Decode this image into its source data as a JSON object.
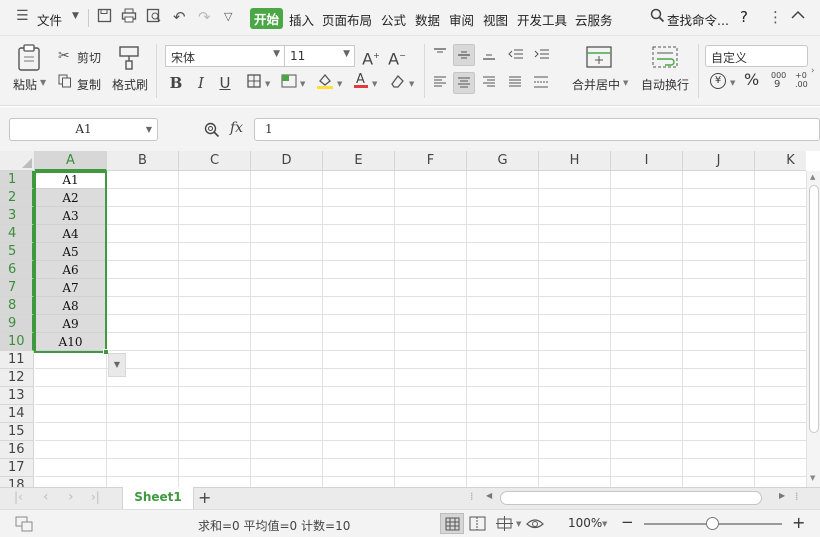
{
  "menubar": {
    "file_label": "文件",
    "tabs": [
      "开始",
      "插入",
      "页面布局",
      "公式",
      "数据",
      "审阅",
      "视图",
      "开发工具",
      "云服务"
    ],
    "search_label": "查找命令...",
    "help_label": "?"
  },
  "ribbon": {
    "paste_label": "粘贴",
    "cut_label": "剪切",
    "copy_label": "复制",
    "format_painter_label": "格式刷",
    "font_name": "宋体",
    "font_size": "11",
    "merge_label": "合并居中",
    "wrap_label": "自动换行",
    "number_format": "自定义",
    "percent_label": "%"
  },
  "formula_bar": {
    "name_box": "A1",
    "fx_label": "fx",
    "formula_value": "1"
  },
  "grid": {
    "columns": [
      "A",
      "B",
      "C",
      "D",
      "E",
      "F",
      "G",
      "H",
      "I",
      "J",
      "K"
    ],
    "rows": [
      "1",
      "2",
      "3",
      "4",
      "5",
      "6",
      "7",
      "8",
      "9",
      "10",
      "11",
      "12",
      "13",
      "14",
      "15",
      "16",
      "17",
      "18"
    ],
    "column_a_values": [
      "A1",
      "A2",
      "A3",
      "A4",
      "A5",
      "A6",
      "A7",
      "A8",
      "A9",
      "A10"
    ]
  },
  "sheet_tabs": {
    "active_sheet": "Sheet1",
    "add_label": "+"
  },
  "statusbar": {
    "summary": "求和=0  平均值=0  计数=10",
    "zoom": "100%"
  },
  "colors": {
    "accent": "#3f9a3f",
    "active_tab_bg": "#4ba746"
  }
}
